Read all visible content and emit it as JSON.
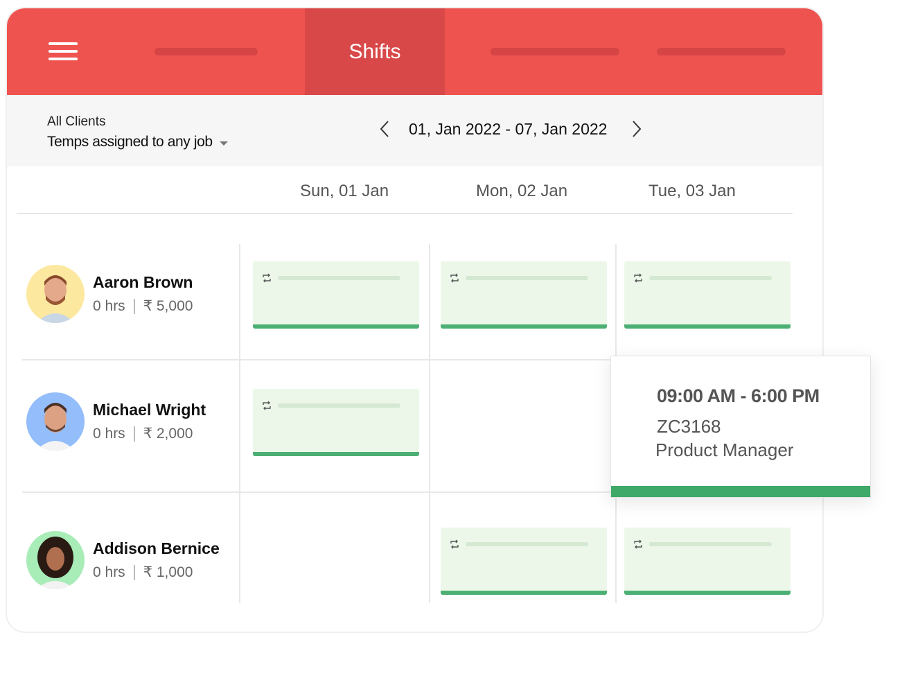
{
  "nav": {
    "active_tab": "Shifts",
    "menu_icon": "hamburger-icon"
  },
  "filters": {
    "client_label": "All Clients",
    "temp_filter": "Temps assigned to any job"
  },
  "date_nav": {
    "range": "01, Jan 2022 - 07, Jan 2022",
    "prev_icon": "chevron-left-icon",
    "next_icon": "chevron-right-icon"
  },
  "days": [
    "Sun, 01 Jan",
    "Mon, 02 Jan",
    "Tue, 03 Jan"
  ],
  "people": [
    {
      "name": "Aaron Brown",
      "hours": "0 hrs",
      "amount": "₹ 5,000",
      "avatar_color": "#fde8a0",
      "shifts": [
        true,
        true,
        true
      ]
    },
    {
      "name": "Michael Wright",
      "hours": "0 hrs",
      "amount": "₹ 2,000",
      "avatar_color": "#93bdfb",
      "shifts": [
        true,
        false,
        false
      ]
    },
    {
      "name": "Addison Bernice",
      "hours": "0 hrs",
      "amount": "₹ 1,000",
      "avatar_color": "#a8ecb8",
      "shifts": [
        false,
        true,
        true
      ]
    }
  ],
  "popup": {
    "time": "09:00 AM - 6:00 PM",
    "code": "ZC3168",
    "role": "Product Manager"
  },
  "colors": {
    "brand": "#ef5350",
    "brand_active": "#d94848",
    "shift_bg": "#ecf7ea",
    "shift_bar": "#4caf73"
  }
}
